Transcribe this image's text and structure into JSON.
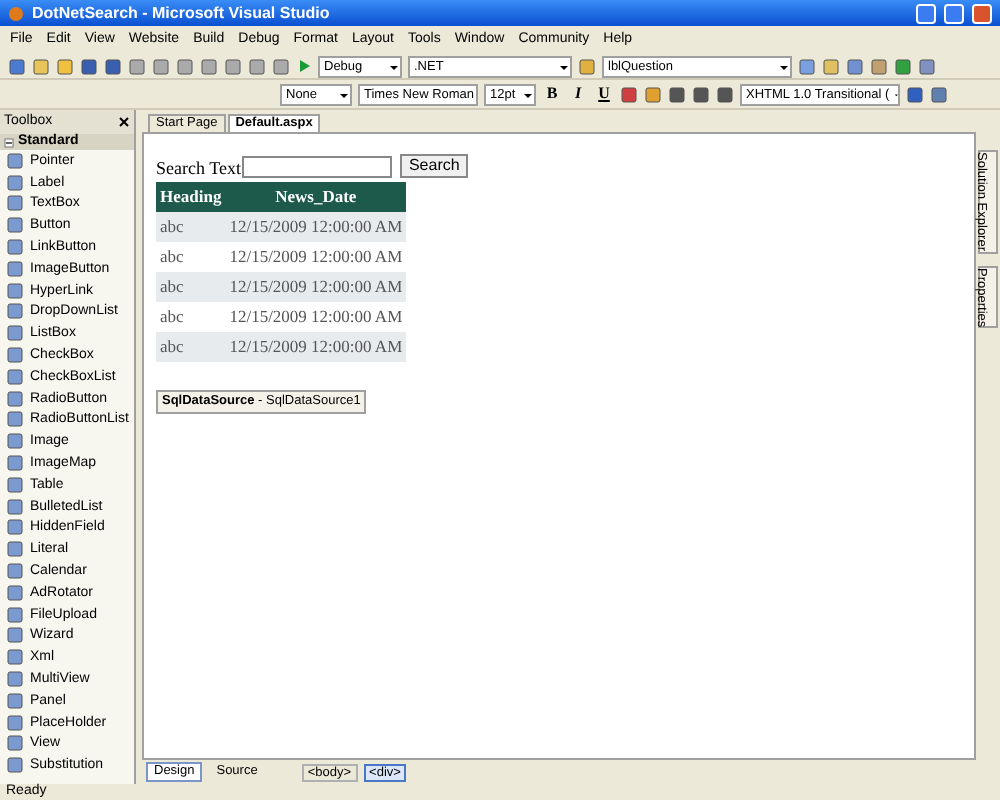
{
  "window": {
    "title": "DotNetSearch - Microsoft Visual Studio"
  },
  "menu": [
    "File",
    "Edit",
    "View",
    "Website",
    "Build",
    "Debug",
    "Format",
    "Layout",
    "Tools",
    "Window",
    "Community",
    "Help"
  ],
  "toolbar": {
    "dropdowns": [
      {
        "value": "Debug"
      },
      {
        "value": ".NET"
      },
      {
        "value": "lblQuestion"
      }
    ]
  },
  "format_toolbar": {
    "block": "None",
    "font": "Times New Roman",
    "size": "12pt",
    "style_buttons": [
      "B",
      "I",
      "U"
    ],
    "schema": "XHTML 1.0 Transitional ("
  },
  "toolbox": {
    "title": "Toolbox",
    "group": "Standard",
    "items": [
      "Pointer",
      "Label",
      "TextBox",
      "Button",
      "LinkButton",
      "ImageButton",
      "HyperLink",
      "DropDownList",
      "ListBox",
      "CheckBox",
      "CheckBoxList",
      "RadioButton",
      "RadioButtonList",
      "Image",
      "ImageMap",
      "Table",
      "BulletedList",
      "HiddenField",
      "Literal",
      "Calendar",
      "AdRotator",
      "FileUpload",
      "Wizard",
      "Xml",
      "MultiView",
      "Panel",
      "PlaceHolder",
      "View",
      "Substitution"
    ]
  },
  "editor": {
    "tabs": [
      {
        "label": "Start Page",
        "selected": false
      },
      {
        "label": "Default.aspx",
        "selected": true
      }
    ],
    "search_label": "Search Text",
    "search_button": "Search",
    "grid": {
      "columns": [
        "Heading",
        "News_Date"
      ],
      "rows": [
        [
          "abc",
          "12/15/2009 12:00:00 AM"
        ],
        [
          "abc",
          "12/15/2009 12:00:00 AM"
        ],
        [
          "abc",
          "12/15/2009 12:00:00 AM"
        ],
        [
          "abc",
          "12/15/2009 12:00:00 AM"
        ],
        [
          "abc",
          "12/15/2009 12:00:00 AM"
        ]
      ]
    },
    "datasource": "**SqlDataSource** - SqlDataSource1",
    "view_tabs": [
      {
        "label": "Design",
        "selected": true
      },
      {
        "label": "Source",
        "selected": false
      }
    ],
    "tags": [
      {
        "label": "<body>",
        "selected": false
      },
      {
        "label": "<div>",
        "selected": true
      }
    ]
  },
  "side_tabs": [
    "Solution Explorer",
    "Properties"
  ],
  "status_bar": "Ready"
}
